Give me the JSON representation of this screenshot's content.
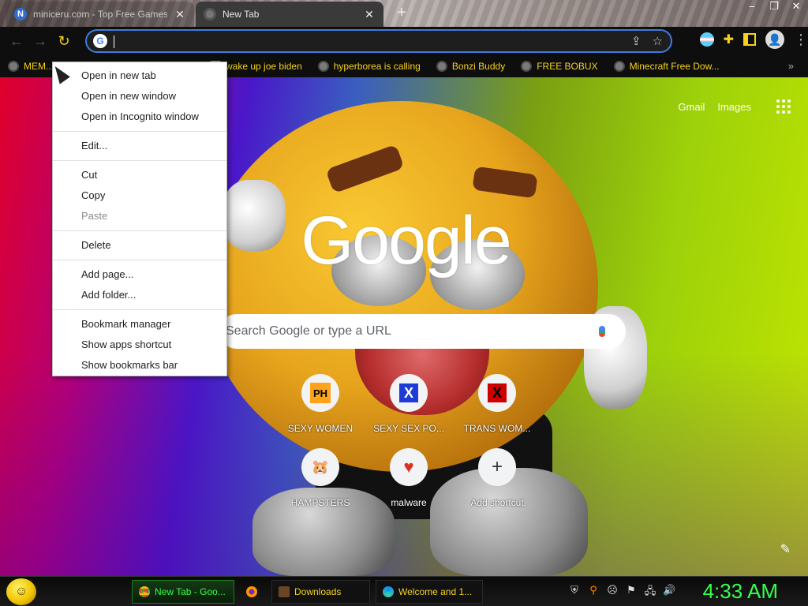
{
  "tabs": [
    {
      "title": "miniceru.com - Top Free Games G...",
      "favicon": "N",
      "active": false
    },
    {
      "title": "New Tab",
      "active": true
    }
  ],
  "window_controls": {
    "minimize": "–",
    "maximize": "❐",
    "close": "✕"
  },
  "toolbar": {
    "back_icon": "←",
    "forward_icon": "→",
    "reload_icon": "↻",
    "address_value": "",
    "share_icon": "⇪",
    "star_icon": "☆",
    "extensions_icon": "✚",
    "menu_icon": "⋮",
    "avatar_icon": "👤"
  },
  "bookmarks": [
    {
      "label": "MEM..."
    },
    {
      "label": "wake up joe biden",
      "grid": true
    },
    {
      "label": "hyperborea is calling"
    },
    {
      "label": "Bonzi Buddy"
    },
    {
      "label": "FREE BOBUX"
    },
    {
      "label": "Minecraft Free Dow..."
    }
  ],
  "bookmarks_more": "»",
  "context_menu": {
    "groups": [
      [
        {
          "label": "Open in new tab"
        },
        {
          "label": "Open in new window"
        },
        {
          "label": "Open in Incognito window"
        }
      ],
      [
        {
          "label": "Edit..."
        }
      ],
      [
        {
          "label": "Cut"
        },
        {
          "label": "Copy"
        },
        {
          "label": "Paste",
          "disabled": true
        }
      ],
      [
        {
          "label": "Delete"
        }
      ],
      [
        {
          "label": "Add page..."
        },
        {
          "label": "Add folder..."
        }
      ],
      [
        {
          "label": "Bookmark manager"
        },
        {
          "label": "Show apps shortcut"
        },
        {
          "label": "Show bookmarks bar"
        }
      ]
    ]
  },
  "newtab": {
    "gmail": "Gmail",
    "images": "Images",
    "logo": "Google",
    "search_placeholder": "Search Google or type a URL",
    "shortcuts": [
      {
        "label": "SEXY WOMEN",
        "icon": "ph-icon",
        "glyph": "PH"
      },
      {
        "label": "SEXY SEX PO...",
        "icon": "x-blue-icon",
        "glyph": "X"
      },
      {
        "label": "TRANS WOM...",
        "icon": "x-red-icon",
        "glyph": "X"
      },
      {
        "label": "HAMPSTERS",
        "icon": "hamster-icon",
        "glyph": "🐹"
      },
      {
        "label": "malware",
        "icon": "heart-icon",
        "glyph": "♥"
      },
      {
        "label": "Add shortcut",
        "icon": "plus-icon",
        "glyph": "+"
      }
    ],
    "edit_icon": "✎"
  },
  "taskbar": {
    "start_glyph": "☺",
    "tasks": [
      {
        "label": "New Tab - Goo...",
        "icon": "chrome-icon"
      },
      {
        "label": "",
        "icon": "firefox-icon"
      },
      {
        "label": "Downloads",
        "icon": "folder-icon"
      },
      {
        "label": "Welcome and 1...",
        "icon": "edge-icon"
      }
    ],
    "tray": [
      "⛨",
      "⚲",
      "☹",
      "⚑",
      "🖧",
      "🔊"
    ],
    "clock": "4:33 AM"
  },
  "colors": {
    "accent_yellow": "#f5d21d",
    "omnibox_focus": "#3d7be0",
    "clock_green": "#35ff4a"
  }
}
